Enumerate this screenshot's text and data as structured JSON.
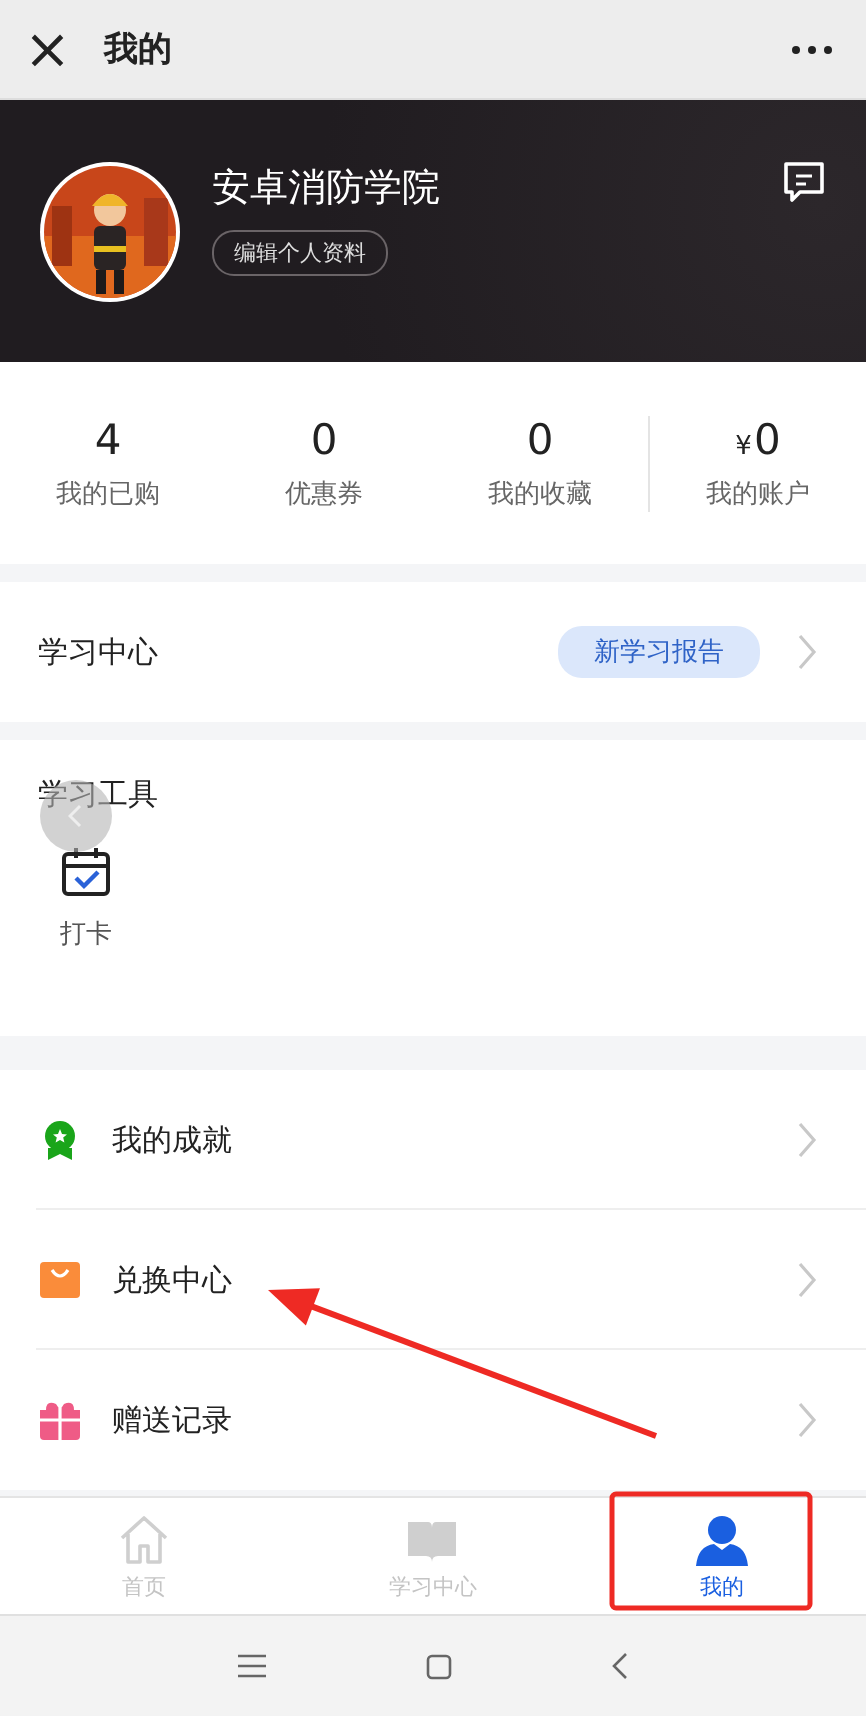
{
  "top_bar": {
    "title": "我的",
    "close": "×"
  },
  "profile": {
    "name": "安卓消防学院",
    "edit_button": "编辑个人资料"
  },
  "stats": [
    {
      "value": "4",
      "label": "我的已购"
    },
    {
      "value": "0",
      "label": "优惠券"
    },
    {
      "value": "0",
      "label": "我的收藏"
    },
    {
      "value": "0",
      "label": "我的账户",
      "currency": "¥"
    }
  ],
  "study_center": {
    "label": "学习中心",
    "badge": "新学习报告"
  },
  "tools": {
    "title": "学习工具",
    "items": [
      {
        "label": "打卡"
      }
    ]
  },
  "menu": [
    {
      "label": "我的成就"
    },
    {
      "label": "兑换中心"
    },
    {
      "label": "赠送记录"
    }
  ],
  "tab_bar": [
    {
      "label": "首页",
      "selected": false
    },
    {
      "label": "学习中心",
      "selected": false
    },
    {
      "label": "我的",
      "selected": true
    }
  ],
  "annotations": [
    {
      "kind": "arrow"
    },
    {
      "kind": "box"
    }
  ]
}
